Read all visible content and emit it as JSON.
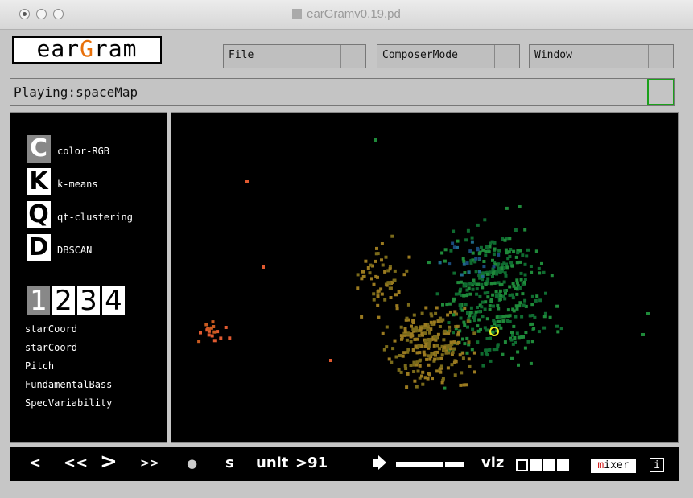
{
  "window": {
    "title": "earGramv0.19.pd"
  },
  "logo": {
    "pre": "ear",
    "accent": "G",
    "post": "ram",
    "accent_color": "#e8700a"
  },
  "menus": [
    {
      "label": "File"
    },
    {
      "label": "ComposerMode"
    },
    {
      "label": "Window"
    }
  ],
  "status": {
    "text": "Playing:spaceMap",
    "indicator_color": "#1aa01a"
  },
  "clustering": [
    {
      "letter": "C",
      "label": "color-RGB",
      "selected": true
    },
    {
      "letter": "K",
      "label": "k-means",
      "selected": false
    },
    {
      "letter": "Q",
      "label": "qt-clustering",
      "selected": false
    },
    {
      "letter": "D",
      "label": "DBSCAN",
      "selected": false
    }
  ],
  "views": [
    {
      "label": "1",
      "selected": true
    },
    {
      "label": "2"
    },
    {
      "label": "3"
    },
    {
      "label": "4"
    }
  ],
  "descriptors": [
    "starCoord",
    "starCoord",
    "Pitch",
    "FundamentalBass",
    "SpecVariability"
  ],
  "transport": {
    "prev": "<",
    "rewind": "<<",
    "play": ">",
    "forward": ">>",
    "record": "●",
    "s": "s",
    "unit_label": "unit",
    "unit_value": ">91",
    "viz_label": "viz",
    "mixer_first": "m",
    "mixer_rest": "ixer",
    "info": "i"
  },
  "map": {
    "background": "#000000",
    "cursor_color": "#f0f020",
    "clusters": [
      {
        "name": "green",
        "color_a": "#0f6b30",
        "color_b": "#1f8a3a"
      },
      {
        "name": "olive",
        "color_a": "#7a6a1a",
        "color_b": "#9a7a20"
      },
      {
        "name": "orange",
        "color_a": "#c85a20",
        "color_b": "#e05a30"
      },
      {
        "name": "blue",
        "color_a": "#1a4a7a",
        "color_b": "#1f6a8a"
      }
    ]
  }
}
